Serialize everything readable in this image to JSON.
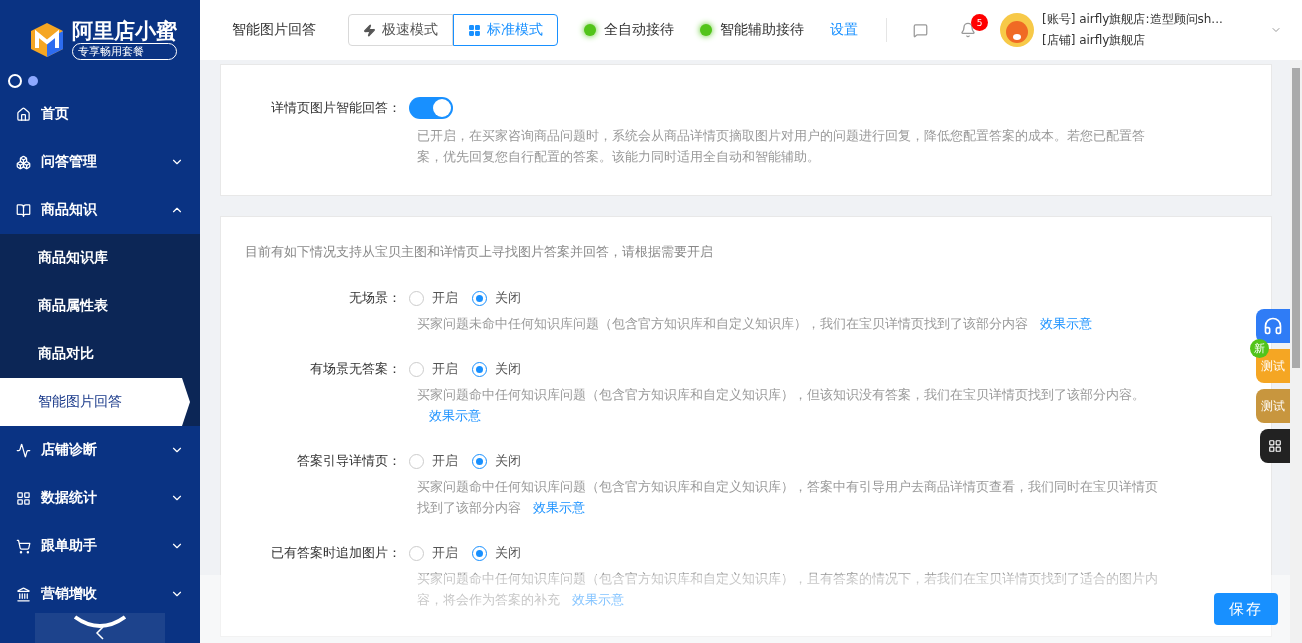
{
  "sidebar": {
    "brand": "阿里店小蜜",
    "plan": "专享畅用套餐",
    "items": [
      {
        "label": "首页"
      },
      {
        "label": "问答管理",
        "expanded": false
      },
      {
        "label": "商品知识",
        "expanded": true,
        "children": [
          {
            "label": "商品知识库",
            "selected": false
          },
          {
            "label": "商品属性表",
            "selected": false
          },
          {
            "label": "商品对比",
            "selected": false
          },
          {
            "label": "智能图片回答",
            "selected": true
          }
        ]
      },
      {
        "label": "店铺诊断",
        "expanded": false
      },
      {
        "label": "数据统计",
        "expanded": false
      },
      {
        "label": "跟单助手",
        "expanded": false
      },
      {
        "label": "营销增收",
        "expanded": false
      }
    ]
  },
  "header": {
    "page_title": "智能图片回答",
    "modes": [
      {
        "label": "极速模式",
        "selected": false
      },
      {
        "label": "标准模式",
        "selected": true
      }
    ],
    "statuses": [
      {
        "label": "全自动接待",
        "on": true
      },
      {
        "label": "智能辅助接待",
        "on": true
      }
    ],
    "settings_link": "设置",
    "notification_count": "5",
    "account": "[账号] airfly旗舰店:造型顾问sh...",
    "shop": "[店铺] airfly旗舰店"
  },
  "feature": {
    "label": "详情页图片智能回答：",
    "on": true,
    "description": "已开启，在买家咨询商品问题时，系统会从商品详情页摘取图片对用户的问题进行回复，降低您配置答案的成本。若您已配置答案，优先回复您自行配置的答案。该能力同时适用全自动和智能辅助。"
  },
  "scenarios": {
    "intro": "目前有如下情况支持从宝贝主图和详情页上寻找图片答案并回答，请根据需要开启",
    "items": [
      {
        "label": "无场景：",
        "choices": [
          {
            "label": "开启",
            "selected": false
          },
          {
            "label": "关闭",
            "selected": true
          }
        ],
        "description": "买家问题未命中任何知识库问题（包含官方知识库和自定义知识库），我们在宝贝详情页找到了该部分内容",
        "link": "效果示意"
      },
      {
        "label": "有场景无答案：",
        "choices": [
          {
            "label": "开启",
            "selected": false
          },
          {
            "label": "关闭",
            "selected": true
          }
        ],
        "description": "买家问题命中任何知识库问题（包含官方知识库和自定义知识库），但该知识没有答案，我们在宝贝详情页找到了该部分内容。",
        "link": "效果示意"
      },
      {
        "label": "答案引导详情页：",
        "choices": [
          {
            "label": "开启",
            "selected": false
          },
          {
            "label": "关闭",
            "selected": true
          }
        ],
        "description": "买家问题命中任何知识库问题（包含官方知识库和自定义知识库），答案中有引导用户去商品详情页查看，我们同时在宝贝详情页找到了该部分内容",
        "link": "效果示意"
      },
      {
        "label": "已有答案时追加图片：",
        "choices": [
          {
            "label": "开启",
            "selected": false
          },
          {
            "label": "关闭",
            "selected": true
          }
        ],
        "description": "买家问题命中任何知识库问题（包含官方知识库和自定义知识库），且有答案的情况下，若我们在宝贝详情页找到了适合的图片内容，将会作为答案的补充",
        "link": "效果示意"
      }
    ]
  },
  "float_tools": [
    {
      "kind": "support"
    },
    {
      "kind": "test",
      "label": "测试",
      "badge": "新",
      "color": "#f5a623"
    },
    {
      "kind": "test",
      "label": "测试",
      "color": "#c8963e"
    },
    {
      "kind": "apps"
    }
  ],
  "save_button": "保存"
}
